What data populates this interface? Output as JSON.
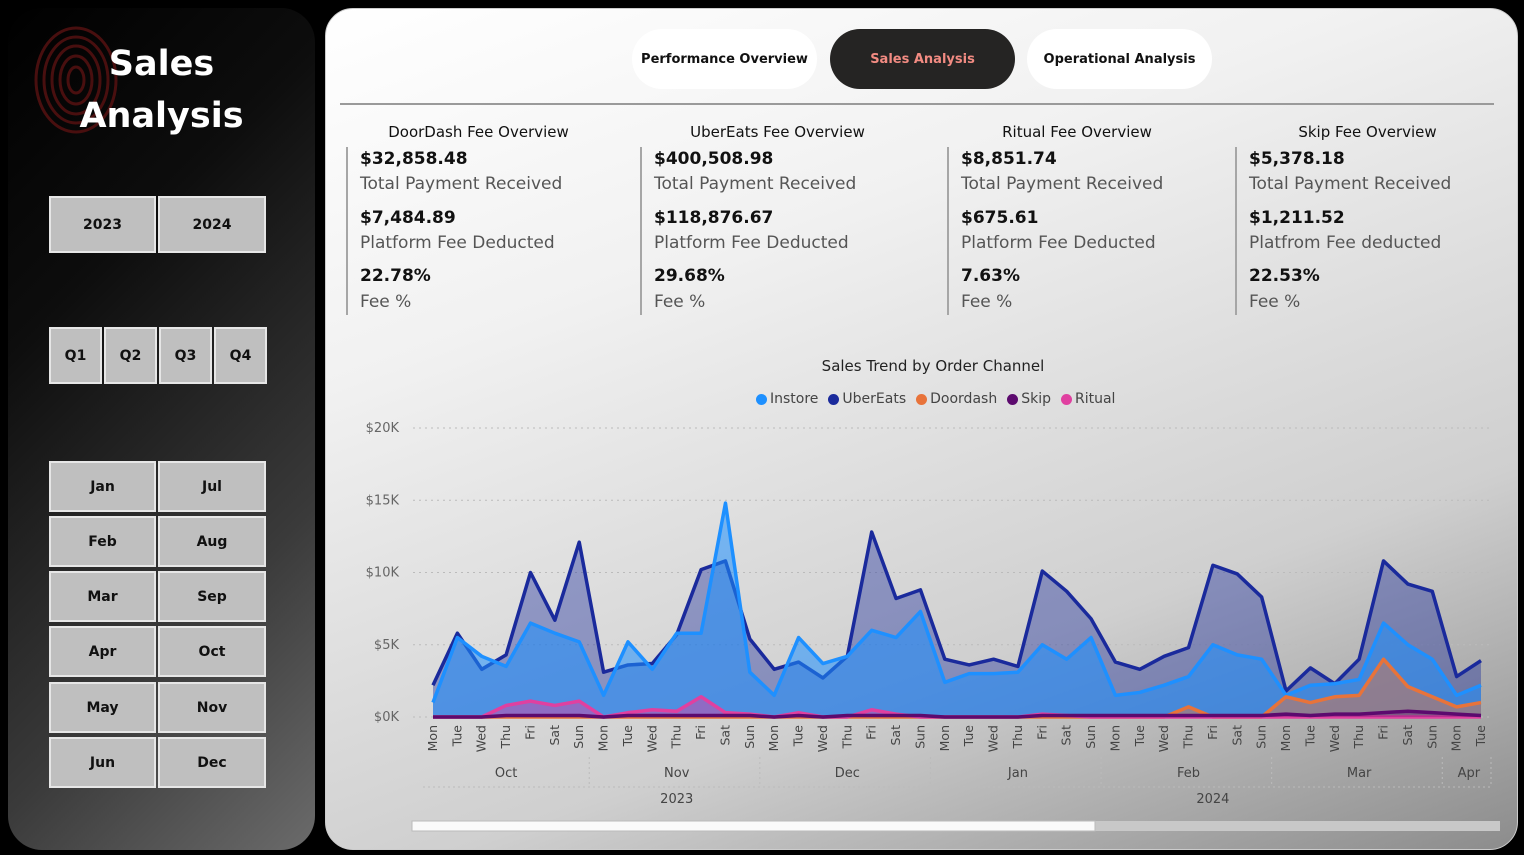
{
  "sidebar": {
    "title_line1": "Sales",
    "title_line2": "Analysis",
    "years": [
      "2023",
      "2024"
    ],
    "quarters": [
      "Q1",
      "Q2",
      "Q3",
      "Q4"
    ],
    "months_left": [
      "Jan",
      "Feb",
      "Mar",
      "Apr",
      "May",
      "Jun"
    ],
    "months_right": [
      "Jul",
      "Aug",
      "Sep",
      "Oct",
      "Nov",
      "Dec"
    ]
  },
  "nav": {
    "performance": "Performance Overview",
    "sales": "Sales Analysis",
    "operational": "Operational Analysis"
  },
  "kpis": [
    {
      "title": "DoorDash Fee Overview",
      "payment": "$32,858.48",
      "payment_label": "Total Payment Received",
      "fee": "$7,484.89",
      "fee_label": "Platform Fee Deducted",
      "pct": "22.78%",
      "pct_label": "Fee %"
    },
    {
      "title": "UberEats Fee Overview",
      "payment": "$400,508.98",
      "payment_label": "Total Payment Received",
      "fee": "$118,876.67",
      "fee_label": "Platform Fee Deducted",
      "pct": "29.68%",
      "pct_label": "Fee %"
    },
    {
      "title": "Ritual Fee Overview",
      "payment": "$8,851.74",
      "payment_label": "Total Payment Received",
      "fee": "$675.61",
      "fee_label": "Platform Fee Deducted",
      "pct": "7.63%",
      "pct_label": "Fee %"
    },
    {
      "title": "Skip Fee Overview",
      "payment": "$5,378.18",
      "payment_label": "Total Payment Received",
      "fee": "$1,211.52",
      "fee_label": "Platfrom Fee deducted",
      "pct": "22.53%",
      "pct_label": "Fee %"
    }
  ],
  "colors": {
    "instore": "#1e90ff",
    "ubereats": "#1a2a9c",
    "doordash": "#e8733a",
    "skip": "#5c0a6e",
    "ritual": "#e040a0",
    "active_nav_text": "#f28b82"
  },
  "chart_data": {
    "type": "area",
    "title": "Sales Trend by Order Channel",
    "ylim": [
      0,
      20000
    ],
    "y_ticks": [
      "$0K",
      "$5K",
      "$10K",
      "$15K",
      "$20K"
    ],
    "x": [
      "Mon",
      "Tue",
      "Wed",
      "Thu",
      "Fri",
      "Sat",
      "Sun",
      "Mon",
      "Tue",
      "Wed",
      "Thu",
      "Fri",
      "Sat",
      "Sun",
      "Mon",
      "Tue",
      "Wed",
      "Thu",
      "Fri",
      "Sat",
      "Sun",
      "Mon",
      "Tue",
      "Wed",
      "Thu",
      "Fri",
      "Sat",
      "Sun",
      "Mon",
      "Tue",
      "Wed",
      "Thu",
      "Fri",
      "Sat",
      "Sun",
      "Mon",
      "Tue",
      "Wed",
      "Thu",
      "Fri",
      "Sat",
      "Sun",
      "Mon",
      "Tue"
    ],
    "months": [
      {
        "label": "Oct",
        "start": 0,
        "end": 7
      },
      {
        "label": "Nov",
        "start": 7,
        "end": 14
      },
      {
        "label": "Dec",
        "start": 14,
        "end": 21
      },
      {
        "label": "Jan",
        "start": 21,
        "end": 28
      },
      {
        "label": "Feb",
        "start": 28,
        "end": 35
      },
      {
        "label": "Mar",
        "start": 35,
        "end": 42
      },
      {
        "label": "Apr",
        "start": 42,
        "end": 44
      }
    ],
    "years": [
      {
        "label": "2023",
        "start": 0,
        "end": 21
      },
      {
        "label": "2024",
        "start": 21,
        "end": 44
      }
    ],
    "grid": true,
    "legend": "top-center",
    "series": [
      {
        "name": "Instore",
        "values": [
          1000,
          5500,
          4200,
          3500,
          6500,
          5800,
          5200,
          1500,
          5200,
          3300,
          5800,
          5800,
          14800,
          3100,
          1500,
          5500,
          3700,
          4200,
          6000,
          5500,
          7300,
          2400,
          3000,
          3000,
          3100,
          5000,
          4000,
          5500,
          1500,
          1700,
          2200,
          2800,
          5000,
          4300,
          4000,
          1500,
          2200,
          2300,
          2600,
          6500,
          5000,
          4000,
          1500,
          2200
        ]
      },
      {
        "name": "UberEats",
        "values": [
          2200,
          5800,
          3300,
          4300,
          10000,
          6700,
          12100,
          3100,
          3600,
          3700,
          5700,
          10200,
          10800,
          5400,
          3300,
          3800,
          2700,
          4200,
          12800,
          8200,
          8800,
          4000,
          3600,
          4000,
          3500,
          10100,
          8700,
          6800,
          3800,
          3300,
          4200,
          4800,
          10500,
          9900,
          8300,
          1800,
          3400,
          2300,
          4000,
          10800,
          9200,
          8700,
          2800,
          3900
        ]
      },
      {
        "name": "Doordash",
        "values": [
          0,
          0,
          0,
          0,
          0,
          0,
          0,
          0,
          0,
          0,
          0,
          0,
          0,
          0,
          0,
          0,
          0,
          0,
          0,
          0,
          0,
          0,
          0,
          0,
          0,
          0,
          0,
          0,
          0,
          0,
          0,
          700,
          0,
          0,
          0,
          1400,
          1000,
          1400,
          1500,
          4000,
          2100,
          1400,
          700,
          1000
        ]
      },
      {
        "name": "Skip",
        "values": [
          0,
          0,
          0,
          100,
          100,
          100,
          100,
          0,
          100,
          100,
          100,
          100,
          100,
          100,
          0,
          100,
          0,
          100,
          100,
          100,
          100,
          0,
          0,
          0,
          0,
          100,
          100,
          100,
          100,
          100,
          100,
          100,
          100,
          100,
          100,
          200,
          100,
          200,
          200,
          300,
          400,
          300,
          200,
          100
        ]
      },
      {
        "name": "Ritual",
        "values": [
          0,
          0,
          0,
          800,
          1100,
          800,
          1100,
          0,
          300,
          500,
          400,
          1400,
          300,
          200,
          0,
          300,
          0,
          0,
          500,
          200,
          0,
          0,
          0,
          0,
          0,
          200,
          100,
          0,
          0,
          0,
          0,
          0,
          0,
          0,
          0,
          0,
          0,
          0,
          0,
          0,
          0,
          0,
          0,
          0
        ]
      }
    ]
  }
}
